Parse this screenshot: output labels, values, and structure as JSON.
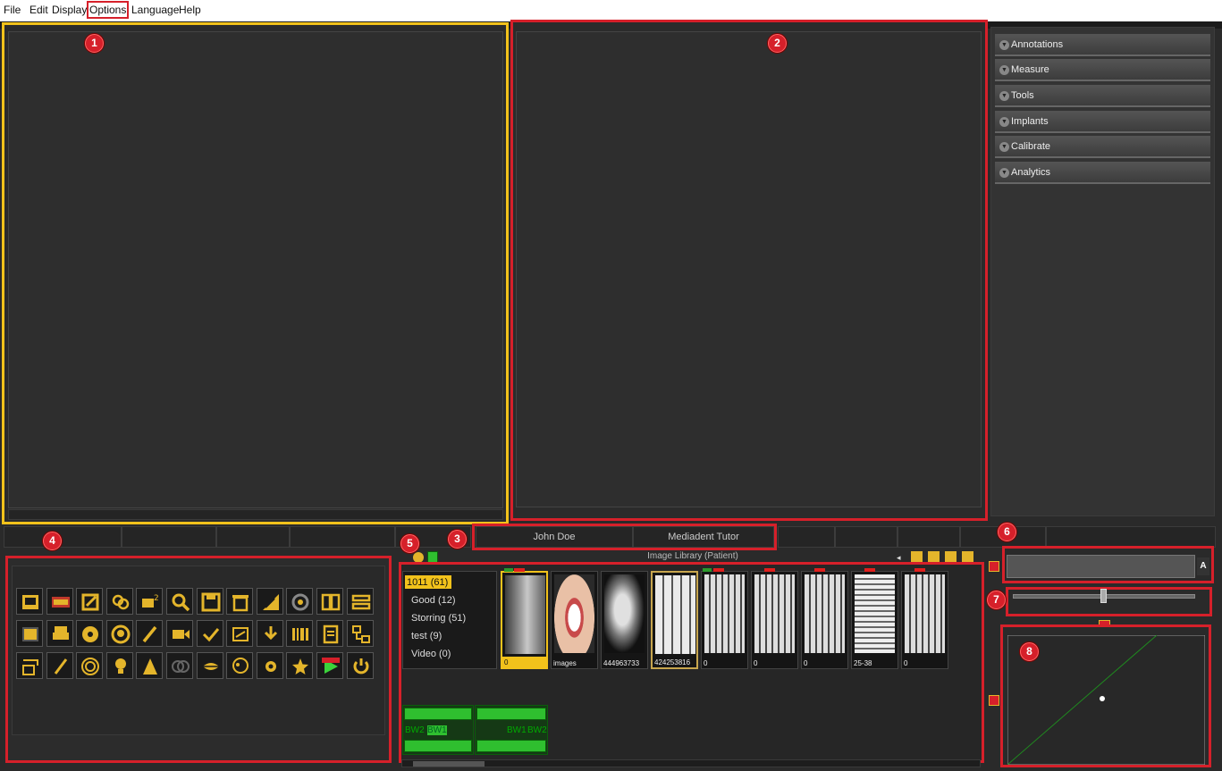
{
  "menu": [
    "File",
    "Edit",
    "Display",
    "Options",
    "Language",
    "Help"
  ],
  "badges": [
    "1",
    "2",
    "3",
    "4",
    "5",
    "6",
    "7",
    "8"
  ],
  "sidebar": {
    "sections": [
      "Annotations",
      "Measure",
      "Tools",
      "Implants",
      "Calibrate",
      "Analytics"
    ]
  },
  "patient": {
    "name": "John Doe",
    "doctor": "Mediadent Tutor"
  },
  "library": {
    "title": "Image Library (Patient)",
    "groups": [
      "1011 (61)",
      "Good (12)",
      "Storring (51)",
      "test (9)",
      "Video (0)"
    ],
    "thumbnails": [
      "0",
      "images",
      "444963733",
      "424253816",
      "0",
      "0",
      "0",
      "25-38",
      "0"
    ],
    "bitewing_labels": [
      "BW2",
      "BW1",
      "BW1",
      "BW2"
    ]
  },
  "input_panel": {
    "button_label": "A"
  },
  "colors": {
    "accent_yellow": "#f2c21b",
    "annotation_red": "#d6202a",
    "icon_gold": "#e4b52b",
    "panel_bg": "#2e2e2e",
    "selection_green": "#2fbf2f"
  },
  "tool_icons": [
    "image-stack-icon",
    "teeth-grid-icon",
    "edit-note-icon",
    "link-chain-icon",
    "compare-2-icon",
    "magnifier-icon",
    "save-disk-icon",
    "trash-icon",
    "ruler-angle-icon",
    "rotate-lens-icon",
    "split-view-icon",
    "align-icon",
    "image-import-icon",
    "printer-icon",
    "xray-radiation-icon",
    "xray-head-icon",
    "brush-icon",
    "video-camera-icon",
    "check-icon",
    "scanner-icon",
    "twain-icon",
    "barcode-icon",
    "document-icon",
    "network-icon",
    "network-export-icon",
    "intraoral-cam-icon",
    "fingerprint-icon",
    "bulb-icon",
    "cone-icon",
    "overlap-circles-icon",
    "lips-icon",
    "skull-icon",
    "gear-settings-icon",
    "star-icon",
    "demo-play-icon",
    "power-icon"
  ]
}
